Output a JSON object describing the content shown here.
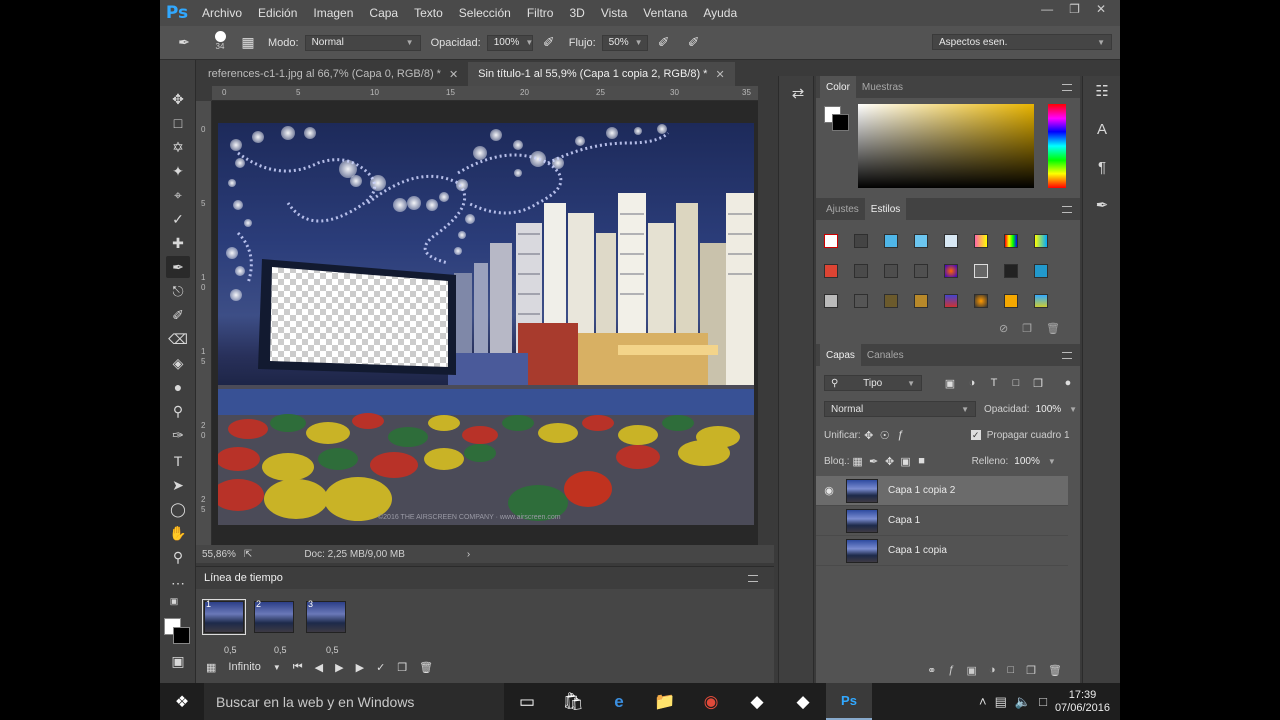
{
  "app": {
    "logo": "Ps"
  },
  "menu": [
    "Archivo",
    "Edición",
    "Imagen",
    "Capa",
    "Texto",
    "Selección",
    "Filtro",
    "3D",
    "Vista",
    "Ventana",
    "Ayuda"
  ],
  "options": {
    "brush_size": "34",
    "mode_label": "Modo:",
    "mode_value": "Normal",
    "opacity_label": "Opacidad:",
    "opacity_value": "100%",
    "flow_label": "Flujo:",
    "flow_value": "50%",
    "workspace": "Aspectos esen."
  },
  "doc_tabs": [
    {
      "label": "references-c1-1.jpg al 66,7% (Capa 0, RGB/8) *"
    },
    {
      "label": "Sin título-1 al 55,9% (Capa 1 copia 2, RGB/8) *"
    }
  ],
  "ruler": {
    "top": [
      "0",
      "5",
      "10",
      "15",
      "20",
      "25",
      "30",
      "35"
    ],
    "left": [
      "0",
      "5",
      "1",
      "0",
      "1",
      "5",
      "2",
      "0",
      "2",
      "5"
    ]
  },
  "status": {
    "zoom": "55,86%",
    "doc": "Doc: 2,25 MB/9,00 MB"
  },
  "watermark": "©2016 THE AIRSCREEN COMPANY · www.airscreen.com",
  "timeline": {
    "title": "Línea de tiempo",
    "frames": [
      {
        "num": "1",
        "delay": "0,5"
      },
      {
        "num": "2",
        "delay": "0,5"
      },
      {
        "num": "3",
        "delay": "0,5"
      }
    ],
    "loop": "Infinito"
  },
  "color_panel": {
    "tabs": [
      "Color",
      "Muestras"
    ]
  },
  "styles_panel": {
    "tabs": [
      "Ajustes",
      "Estilos"
    ]
  },
  "layers_panel": {
    "tabs": [
      "Capas",
      "Canales"
    ],
    "filter": "Tipo",
    "blend": "Normal",
    "opacity_label": "Opacidad:",
    "opacity_value": "100%",
    "unify_label": "Unificar:",
    "propagate_label": "Propagar cuadro 1",
    "lock_label": "Bloq.:",
    "fill_label": "Relleno:",
    "fill_value": "100%",
    "layers": [
      {
        "name": "Capa 1 copia 2",
        "visible": true,
        "selected": true
      },
      {
        "name": "Capa 1",
        "visible": false,
        "selected": false
      },
      {
        "name": "Capa 1 copia",
        "visible": false,
        "selected": false
      }
    ]
  },
  "taskbar": {
    "search_placeholder": "Buscar en la web y en Windows",
    "time": "17:39",
    "date": "07/06/2016"
  },
  "colors": {
    "ps_blue": "#31a8ff",
    "panel_bg": "#535353",
    "app_bg": "#3a3a3a"
  }
}
